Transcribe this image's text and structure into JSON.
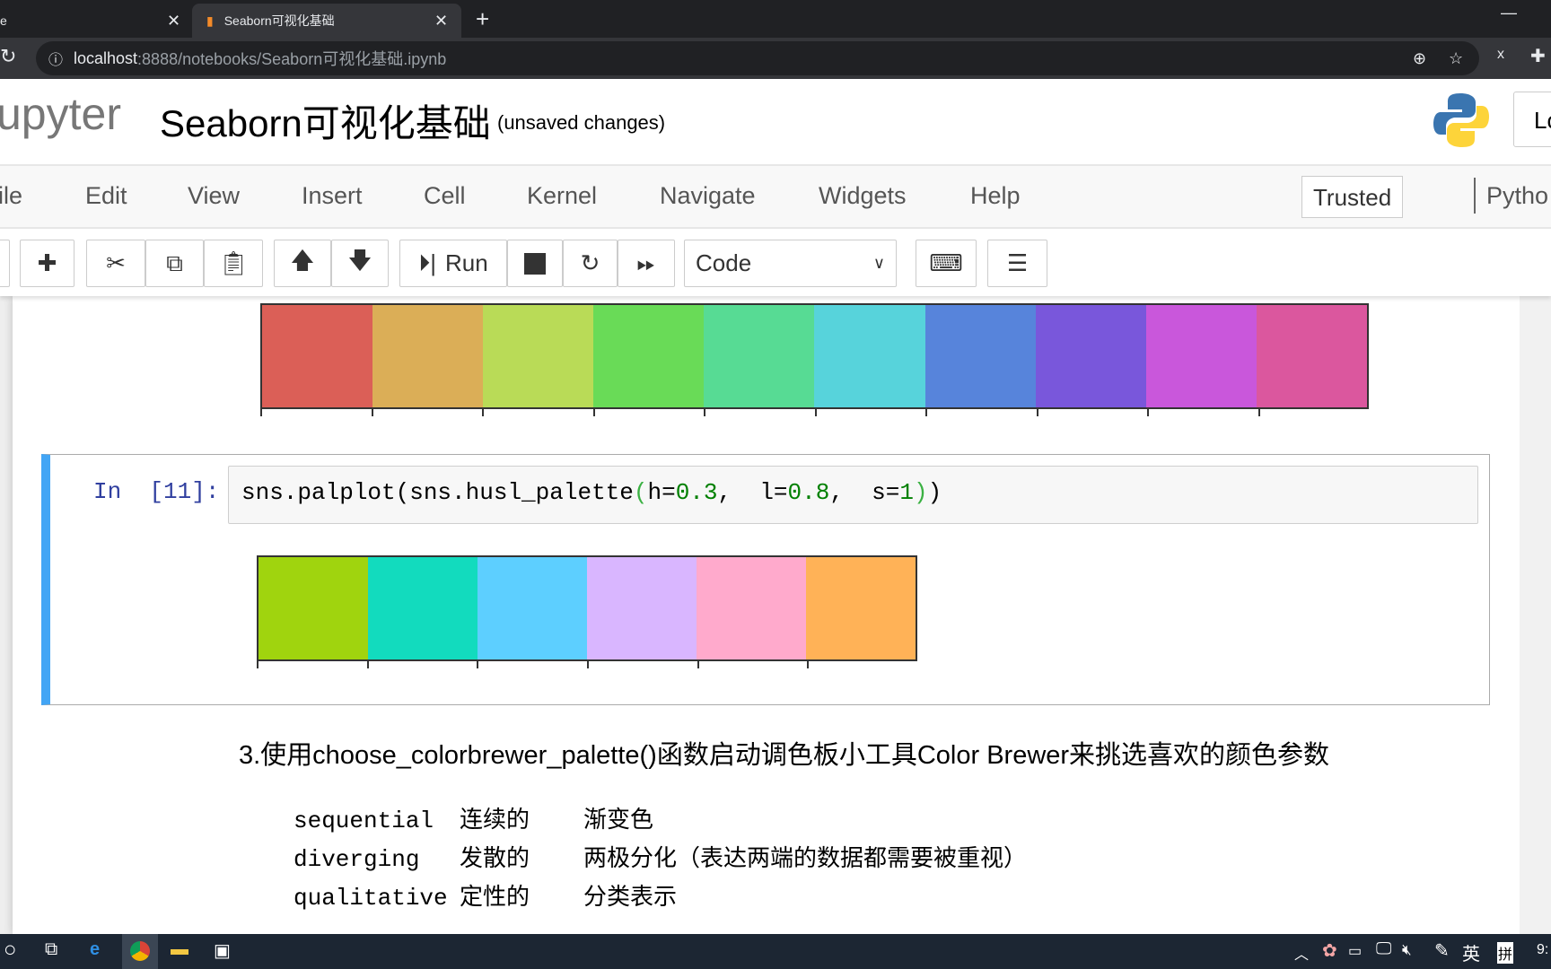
{
  "browser": {
    "tabs": [
      {
        "label": "e"
      },
      {
        "label": "Seaborn可视化基础",
        "active": true
      }
    ],
    "url_host": "localhost",
    "url_path": ":8888/notebooks/Seaborn可视化基础.ipynb"
  },
  "header": {
    "logo": "upyter",
    "title": "Seaborn可视化基础",
    "status": "(unsaved changes)",
    "login": "Lo"
  },
  "menu": {
    "items": [
      "ile",
      "Edit",
      "View",
      "Insert",
      "Cell",
      "Kernel",
      "Navigate",
      "Widgets",
      "Help"
    ],
    "trusted": "Trusted",
    "kernel": "Pytho"
  },
  "toolbar": {
    "run": "Run",
    "cell_type": "Code"
  },
  "palette_top": {
    "colors": [
      "#db5f57",
      "#dbae57",
      "#b9db57",
      "#69db57",
      "#57db94",
      "#57d3db",
      "#5784db",
      "#7957db",
      "#c957db",
      "#db579e"
    ]
  },
  "cell": {
    "prompt": "In  [11]:",
    "code_parts": [
      {
        "t": "sns.palplot(sns.husl_palette",
        "c": "#000"
      },
      {
        "t": "(",
        "c": "#3bb143"
      },
      {
        "t": "h=",
        "c": "#000"
      },
      {
        "t": "0.3",
        "c": "#008000"
      },
      {
        "t": ",  l=",
        "c": "#000"
      },
      {
        "t": "0.8",
        "c": "#008000"
      },
      {
        "t": ",  s=",
        "c": "#000"
      },
      {
        "t": "1",
        "c": "#008000"
      },
      {
        "t": ")",
        "c": "#3bb143"
      },
      {
        "t": ")",
        "c": "#000"
      }
    ],
    "palette": [
      "#a0d40e",
      "#12dbbe",
      "#5dcfff",
      "#d9b6ff",
      "#ffaacc",
      "#ffb257"
    ]
  },
  "markdown": {
    "heading": "3.使用choose_colorbrewer_palette()函数启动调色板小工具Color Brewer来挑选喜欢的颜色参数",
    "rows": [
      {
        "term": "sequential ",
        "cn": "连续的",
        "desc": "渐变色"
      },
      {
        "term": "diverging  ",
        "cn": "发散的",
        "desc": "两极分化（表达两端的数据都需要被重视）"
      },
      {
        "term": "qualitative",
        "cn": "定性的",
        "desc": "分类表示"
      }
    ]
  },
  "taskbar": {
    "ime": "英",
    "ime2": "拼",
    "clock": "9:"
  }
}
